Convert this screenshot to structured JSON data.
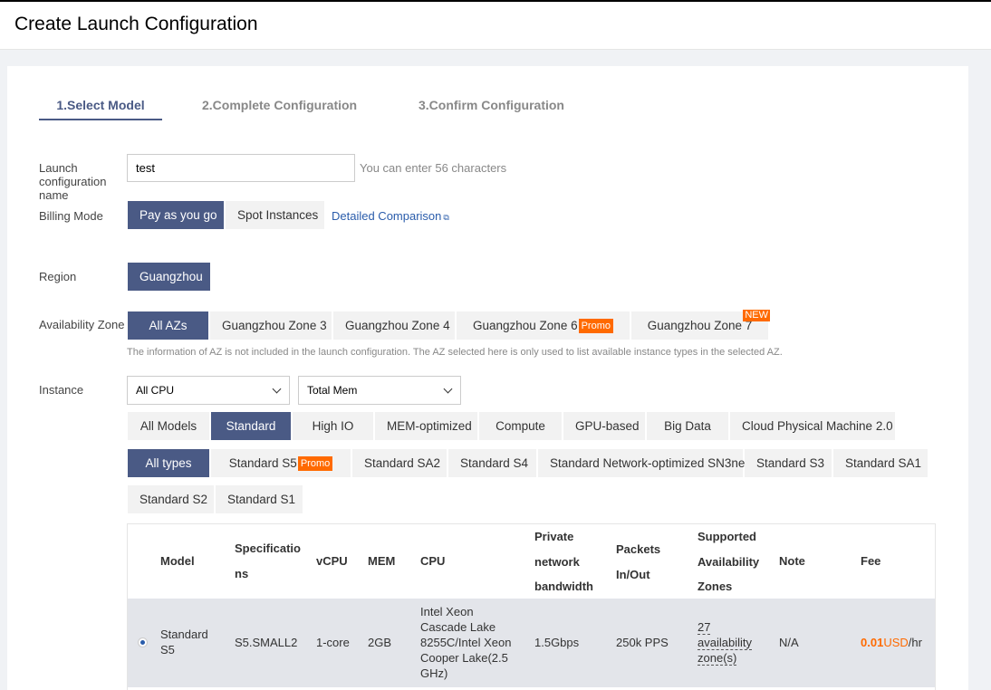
{
  "header": {
    "title": "Create Launch Configuration"
  },
  "steps": [
    "1.Select Model",
    "2.Complete Configuration",
    "3.Confirm Configuration"
  ],
  "form": {
    "name_label": "Launch configuration name",
    "name_value": "test",
    "name_hint": "You can enter 56 characters",
    "billing_label": "Billing Mode",
    "billing_options": [
      "Pay as you go",
      "Spot Instances"
    ],
    "billing_link": "Detailed Comparison",
    "region_label": "Region",
    "region_value": "Guangzhou",
    "az_label": "Availability Zone",
    "az_options": [
      "All AZs",
      "Guangzhou Zone 3",
      "Guangzhou Zone 4",
      "Guangzhou Zone 6",
      "Guangzhou Zone 7"
    ],
    "promo_badge": "Promo",
    "new_badge": "NEW",
    "az_note": "The information of AZ is not included in the launch configuration. The AZ selected here is only used to list available instance types in the selected AZ.",
    "instance_label": "Instance",
    "cpu_select": "All CPU",
    "mem_select": "Total Mem",
    "model_tabs": [
      "All Models",
      "Standard",
      "High IO",
      "MEM-optimized",
      "Compute",
      "GPU-based",
      "Big Data",
      "Cloud Physical Machine 2.0"
    ],
    "type_tabs": [
      "All types",
      "Standard S5",
      "Standard SA2",
      "Standard S4",
      "Standard Network-optimized SN3ne",
      "Standard S3",
      "Standard SA1",
      "Standard S2",
      "Standard S1"
    ]
  },
  "table": {
    "headers": {
      "model": "Model",
      "spec_1": "Specificatio",
      "spec_2": "ns",
      "vcpu": "vCPU",
      "mem": "MEM",
      "cpu": "CPU",
      "bw_1": "Private",
      "bw_2": "network",
      "bw_3": "bandwidth",
      "pps_1": "Packets",
      "pps_2": "In/Out",
      "az_1": "Supported",
      "az_2": "Availability",
      "az_3": "Zones",
      "note": "Note",
      "fee": "Fee"
    },
    "rows": [
      {
        "model_1": "Standard",
        "model_2": "S5",
        "spec": "S5.SMALL2",
        "vcpu": "1-core",
        "mem": "2GB",
        "cpu_1": "Intel Xeon",
        "cpu_2": "Cascade Lake",
        "cpu_3": "8255C/Intel Xeon",
        "cpu_4": "Cooper Lake(2.5",
        "cpu_5": "GHz)",
        "bandwidth": "1.5Gbps",
        "pps": "250k PPS",
        "az_1": "27",
        "az_2": "availability",
        "az_3": "zone(s)",
        "note": "N/A",
        "fee_value": "0.01",
        "fee_unit": "USD",
        "fee_suffix": "/hr"
      }
    ]
  },
  "colors": {
    "accent": "#4a5a85",
    "promo": "#ff6a00",
    "link": "#2a5cab"
  }
}
